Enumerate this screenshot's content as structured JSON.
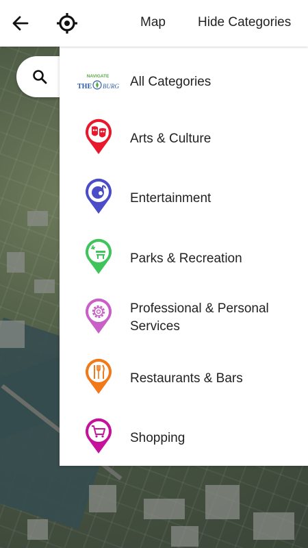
{
  "header": {
    "map_label": "Map",
    "hide_label": "Hide Categories"
  },
  "logo": {
    "top_text": "NAVIGATE",
    "left_text": "THE",
    "right_text": "BURG"
  },
  "categories": [
    {
      "label": "All Categories",
      "icon": "navigate-the-burg-logo",
      "color": ""
    },
    {
      "label": "Arts & Culture",
      "icon": "theater-masks-icon",
      "color": "#e8192c"
    },
    {
      "label": "Entertainment",
      "icon": "music-note-icon",
      "color": "#4b4cc8"
    },
    {
      "label": "Parks & Recreation",
      "icon": "park-bench-icon",
      "color": "#3ec45a"
    },
    {
      "label": "Professional & Personal Services",
      "icon": "gear-icon",
      "color": "#c860c8"
    },
    {
      "label": "Restaurants & Bars",
      "icon": "utensils-icon",
      "color": "#f07a1a"
    },
    {
      "label": "Shopping",
      "icon": "shopping-cart-icon",
      "color": "#c5129a"
    }
  ]
}
